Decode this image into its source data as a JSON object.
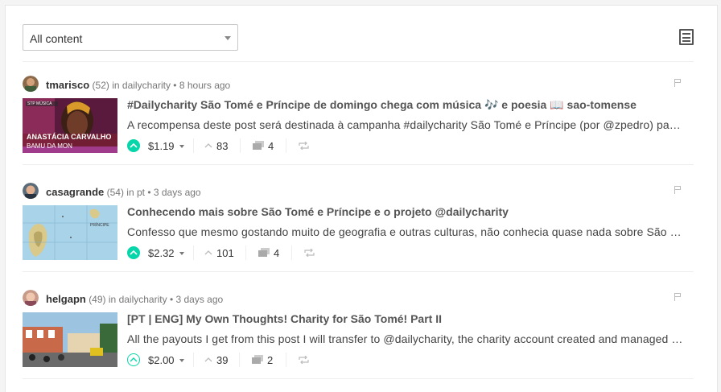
{
  "filter": {
    "selected": "All content"
  },
  "posts": [
    {
      "author": "tmarisco",
      "reputation": "(52)",
      "in_word": "in",
      "community": "dailycharity",
      "time": "• 8 hours ago",
      "title": "#Dailycharity São Tomé e Príncipe de domingo chega com música 🎶 e poesia 📖 sao-tomense",
      "excerpt": "A recompensa deste post será destinada à campanha #dailycharity São Tomé e Príncipe (por @zpedro) pa…",
      "payout": "$1.19",
      "votes": "83",
      "comments": "4",
      "voted": true,
      "thumb_caption_1": "ANASTÁCIA CARVALHO",
      "thumb_caption_2": "BAMU DA MON",
      "thumb_logo": "STP MÚSICA"
    },
    {
      "author": "casagrande",
      "reputation": "(54)",
      "in_word": "in",
      "community": "pt",
      "time": "• 3 days ago",
      "title": "Conhecendo mais sobre São Tomé e Príncipe e o projeto @dailycharity",
      "excerpt": "Confesso que mesmo gostando muito de geografia e outras culturas, não conhecia quase nada sobre São …",
      "payout": "$2.32",
      "votes": "101",
      "comments": "4",
      "voted": true,
      "thumb_label": "PRÍNCIPE"
    },
    {
      "author": "helgapn",
      "reputation": "(49)",
      "in_word": "in",
      "community": "dailycharity",
      "time": "• 3 days ago",
      "title": "[PT | ENG] My Own Thoughts! Charity for São Tomé! Part II",
      "excerpt": "All the payouts I get from this post I will transfer to @dailycharity, the charity account created and managed …",
      "payout": "$2.00",
      "votes": "39",
      "comments": "2",
      "voted": false
    }
  ],
  "colors": {
    "accent": "#06d6a9"
  }
}
